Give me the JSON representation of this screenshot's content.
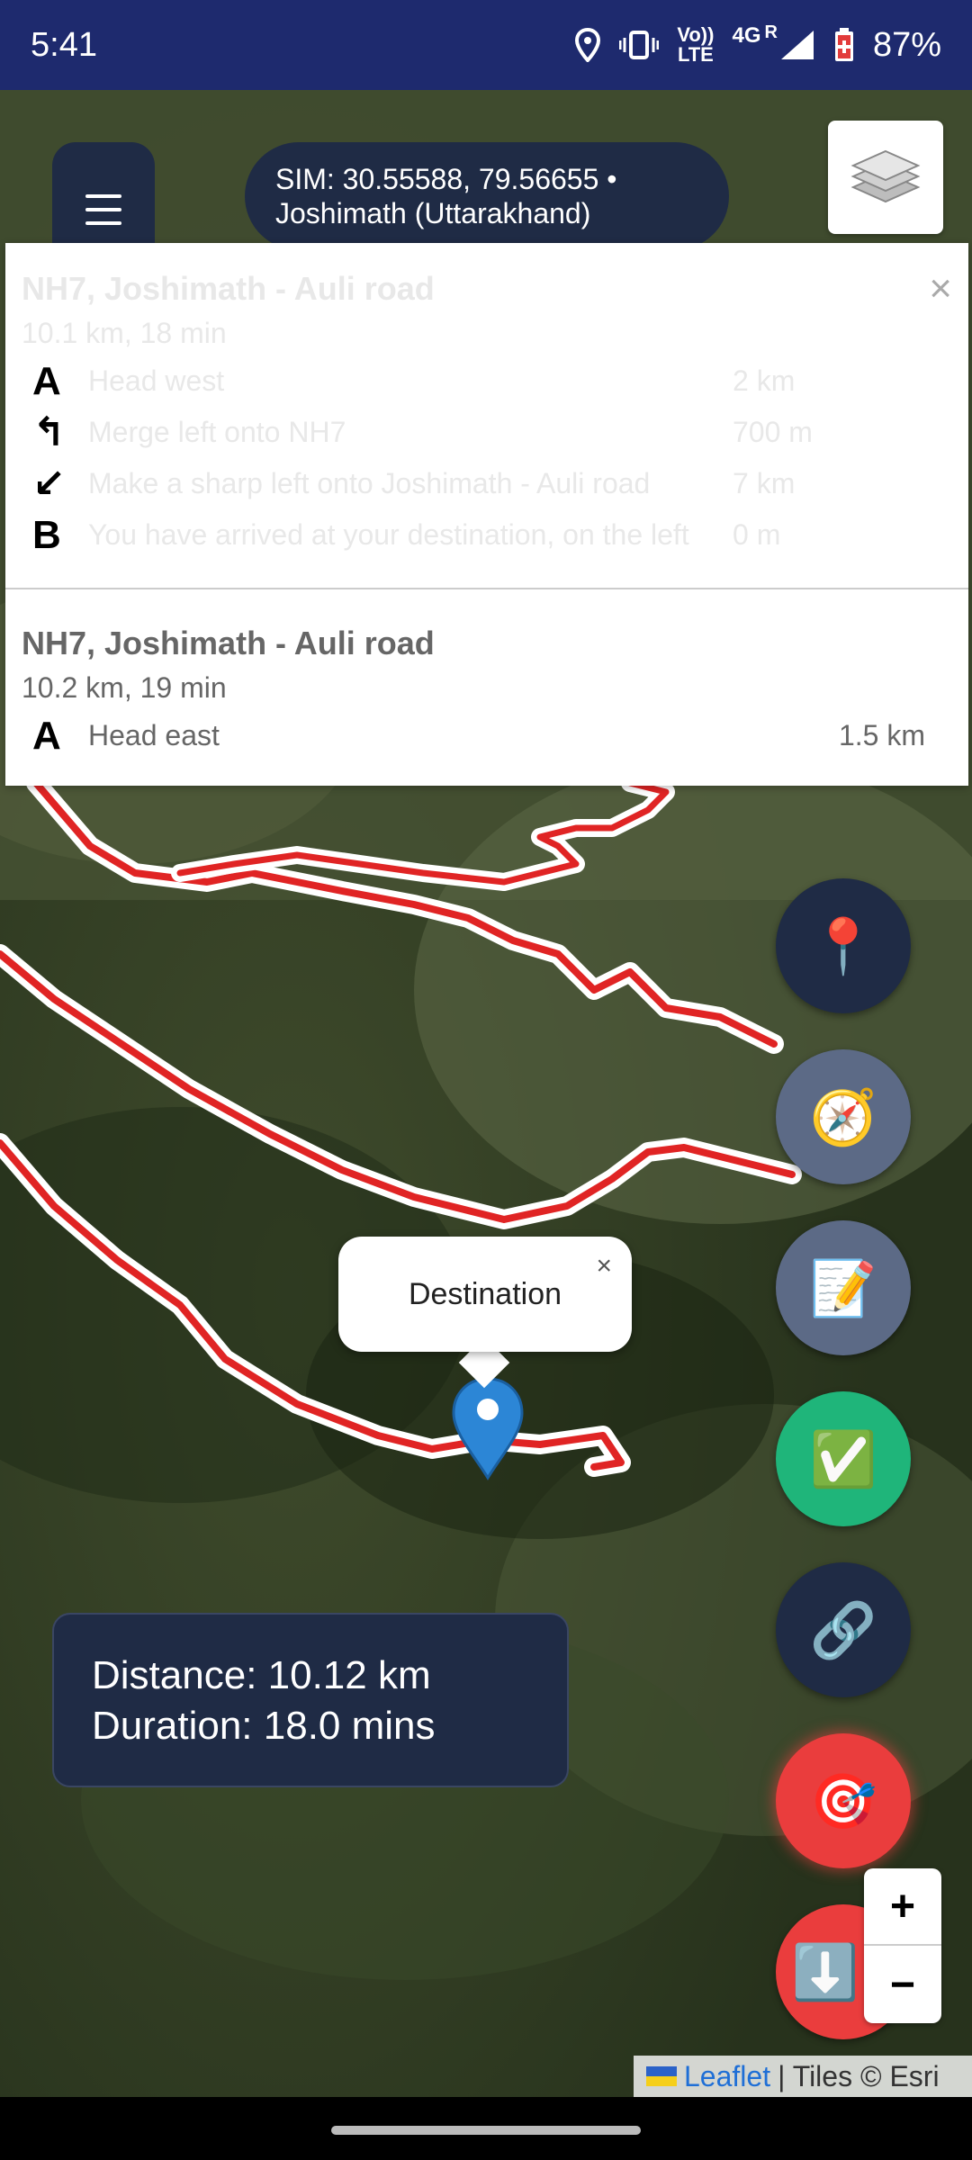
{
  "status_bar": {
    "time": "5:41",
    "lte_top": "Vo))",
    "lte_bottom": "LTE",
    "network": "4G",
    "roaming": "R",
    "battery": "87%"
  },
  "sim": {
    "line1": "SIM: 30.55588, 79.56655 •",
    "line2": "Joshimath (Uttarakhand)"
  },
  "route_panel": {
    "close_label": "×",
    "routes": [
      {
        "name": "NH7, Joshimath - Auli road",
        "summary": "10.1 km, 18 min",
        "steps": [
          {
            "symbol": "A",
            "text": "Head west",
            "distance": "2 km"
          },
          {
            "symbol": "↰",
            "text": "Merge left onto NH7",
            "distance": "700 m"
          },
          {
            "symbol": "↙",
            "text": "Make a sharp left onto Joshimath - Auli road",
            "distance": "7 km"
          },
          {
            "symbol": "B",
            "text": "You have arrived at your destination, on the left",
            "distance": "0 m"
          }
        ]
      },
      {
        "name": "NH7, Joshimath - Auli road",
        "summary": "10.2 km, 19 min",
        "steps": [
          {
            "symbol": "A",
            "text": "Head east",
            "distance": "1.5 km"
          }
        ]
      }
    ]
  },
  "fabs": {
    "location": "📍",
    "compass": "🧭",
    "notes": "📝",
    "check": "✅",
    "link": "🔗",
    "target": "🎯",
    "download": "⬇️"
  },
  "popup": {
    "label": "Destination",
    "close": "×"
  },
  "info": {
    "distance": "Distance: 10.12 km",
    "duration": "Duration: 18.0 mins"
  },
  "zoom": {
    "in": "+",
    "out": "−"
  },
  "attribution": {
    "leaflet": "Leaflet",
    "tiles": "| Tiles © Esri"
  },
  "colors": {
    "status_bar": "#1e2a6e",
    "dark_panel": "#1f2b45",
    "route_line": "#e02424",
    "fab_green": "#1fb57a",
    "fab_red": "#ea3d3d",
    "fab_gray": "#5c6a86",
    "marker_blue": "#2c86d6"
  }
}
